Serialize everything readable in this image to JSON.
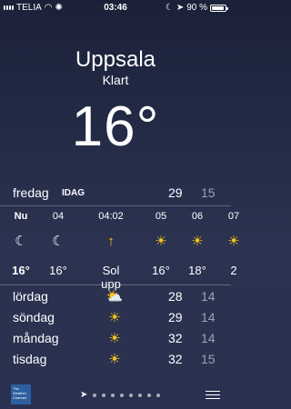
{
  "status_bar": {
    "carrier": "TELIA",
    "time": "03:46",
    "battery_percent_text": "90 %",
    "battery_level": 0.9
  },
  "current": {
    "city": "Uppsala",
    "condition": "Klart",
    "temperature": "16°"
  },
  "today": {
    "day": "fredag",
    "label": "IDAG",
    "high": "29",
    "low": "15"
  },
  "hourly": [
    {
      "hour": "Nu",
      "icon": "moon-stars-icon",
      "glyph": "☾",
      "temp": "16°",
      "now": true
    },
    {
      "hour": "04",
      "icon": "moon-stars-icon",
      "glyph": "☾",
      "temp": "16°"
    },
    {
      "hour": "04:02",
      "icon": "sunrise-icon",
      "glyph": "↑",
      "temp": "Sol upp"
    },
    {
      "hour": "05",
      "icon": "sun-icon",
      "glyph": "☀",
      "temp": "16°"
    },
    {
      "hour": "06",
      "icon": "sun-icon",
      "glyph": "☀",
      "temp": "18°"
    },
    {
      "hour": "07",
      "icon": "sun-icon",
      "glyph": "☀",
      "temp": "2"
    }
  ],
  "daily": [
    {
      "day": "lördag",
      "icon": "partly-cloudy-icon",
      "glyph": "⛅",
      "high": "28",
      "low": "14"
    },
    {
      "day": "söndag",
      "icon": "sun-icon",
      "glyph": "☀",
      "high": "29",
      "low": "14"
    },
    {
      "day": "måndag",
      "icon": "sun-icon",
      "glyph": "☀",
      "high": "32",
      "low": "14"
    },
    {
      "day": "tisdag",
      "icon": "sun-icon",
      "glyph": "☀",
      "high": "32",
      "low": "15"
    }
  ],
  "footer": {
    "logo_text": "The Weather Channel",
    "page_dots": 8
  },
  "colors": {
    "background_top": "#1b2138",
    "background_bottom": "#2a3150",
    "sun": "#f5c518",
    "muted": "#9aa2b8"
  }
}
